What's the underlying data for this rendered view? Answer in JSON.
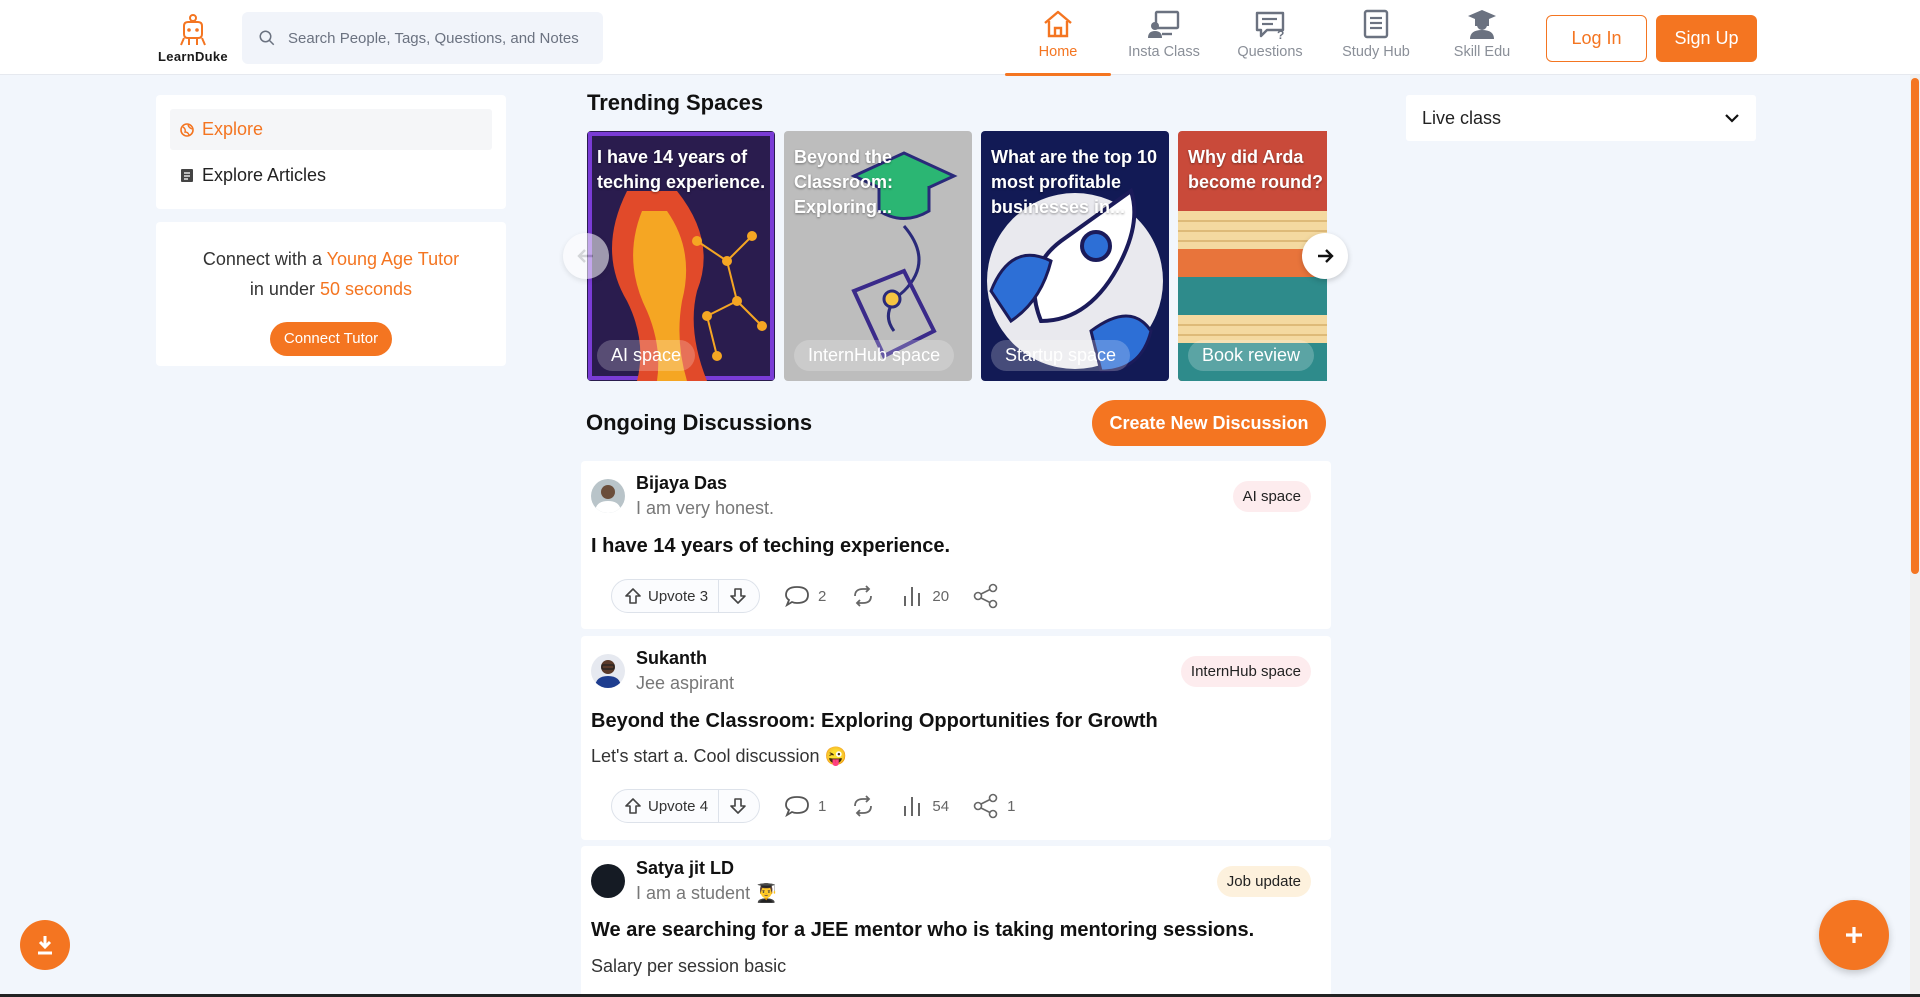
{
  "brand": {
    "name": "LearnDuke"
  },
  "search": {
    "placeholder": "Search People, Tags, Questions, and Notes"
  },
  "nav": [
    {
      "label": "Home",
      "icon": "home-icon",
      "active": true
    },
    {
      "label": "Insta Class",
      "icon": "insta-class-icon"
    },
    {
      "label": "Questions",
      "icon": "questions-icon"
    },
    {
      "label": "Study Hub",
      "icon": "study-hub-icon"
    },
    {
      "label": "Skill Edu",
      "icon": "skill-edu-icon"
    }
  ],
  "auth": {
    "login": "Log In",
    "signup": "Sign Up"
  },
  "sidebar": {
    "items": [
      {
        "label": "Explore",
        "icon": "globe-icon",
        "active": true
      },
      {
        "label": "Explore Articles",
        "icon": "article-icon"
      }
    ],
    "tutor": {
      "line1_prefix": "Connect with a ",
      "line1_highlight": "Young Age Tutor",
      "line2_prefix": "in under ",
      "line2_highlight": "50 seconds",
      "button": "Connect Tutor"
    }
  },
  "trending": {
    "title": "Trending Spaces",
    "cards": [
      {
        "caption": "I have 14 years of teching experience.",
        "tag": "AI space"
      },
      {
        "caption": "Beyond the Classroom: Exploring...",
        "tag": "InternHub space"
      },
      {
        "caption": "What are the top 10 most profitable businesses in...",
        "tag": "Startup space"
      },
      {
        "caption": "Why did Arda become round?",
        "tag": "Book review"
      }
    ]
  },
  "discussions": {
    "title": "Ongoing Discussions",
    "create_button": "Create New Discussion",
    "posts": [
      {
        "author": "Bijaya Das",
        "bio": "I am very honest.",
        "space": "AI space",
        "title": "I have 14 years of teching experience.",
        "body": "",
        "upvote": "Upvote 3",
        "comments": "2",
        "views": "20",
        "shares": ""
      },
      {
        "author": "Sukanth",
        "bio": "Jee aspirant",
        "space": "InternHub space",
        "title": "Beyond the Classroom: Exploring Opportunities for Growth",
        "body": "Let's start a. Cool discussion 😜",
        "upvote": "Upvote 4",
        "comments": "1",
        "views": "54",
        "shares": "1"
      },
      {
        "author": "Satya jit LD",
        "bio": "I am a student 👨‍🎓",
        "space": "Job update",
        "title": "We are searching for a JEE mentor who is taking mentoring sessions.",
        "body": "Salary per session basic"
      }
    ]
  },
  "right": {
    "live_select": "Live class"
  },
  "colors": {
    "accent": "#f47521",
    "background": "#f2f6fc"
  }
}
